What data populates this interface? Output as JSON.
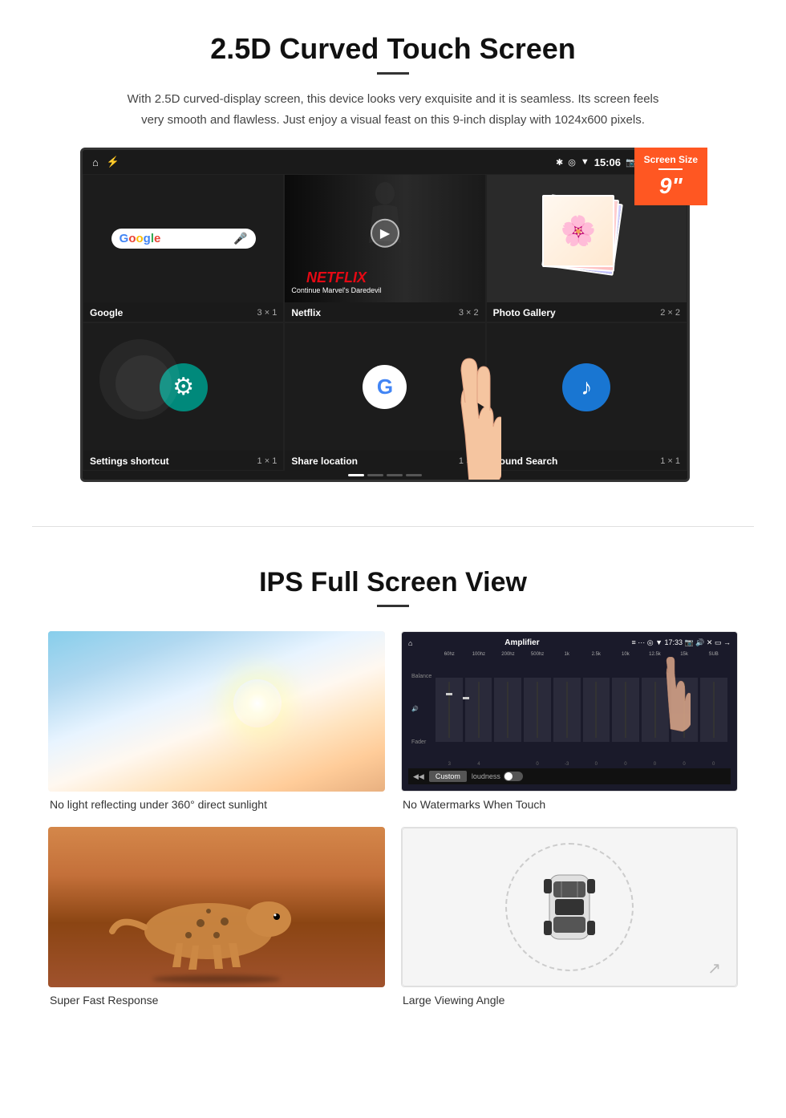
{
  "section1": {
    "title": "2.5D Curved Touch Screen",
    "description": "With 2.5D curved-display screen, this device looks very exquisite and it is seamless. Its screen feels very smooth and flawless. Just enjoy a visual feast on this 9-inch display with 1024x600 pixels.",
    "badge": {
      "label": "Screen Size",
      "size": "9\""
    },
    "statusBar": {
      "time": "15:06"
    },
    "apps": [
      {
        "name": "Google",
        "size": "3 × 1"
      },
      {
        "name": "Netflix",
        "size": "3 × 2"
      },
      {
        "name": "Photo Gallery",
        "size": "2 × 2"
      },
      {
        "name": "Settings shortcut",
        "size": "1 × 1"
      },
      {
        "name": "Share location",
        "size": "1 × 1"
      },
      {
        "name": "Sound Search",
        "size": "1 × 1"
      }
    ],
    "netflix": {
      "logo": "NETFLIX",
      "subtitle": "Continue Marvel's Daredevil"
    },
    "slideIndicator": [
      "active",
      "inactive",
      "inactive",
      "inactive"
    ]
  },
  "section2": {
    "title": "IPS Full Screen View",
    "cards": [
      {
        "caption": "No light reflecting under 360° direct sunlight"
      },
      {
        "caption": "No Watermarks When Touch"
      },
      {
        "caption": "Super Fast Response"
      },
      {
        "caption": "Large Viewing Angle"
      }
    ],
    "amplifier": {
      "title": "Amplifier",
      "time": "17:33",
      "labels": [
        "60hz",
        "100hz",
        "200hz",
        "500hz",
        "1k",
        "2.5k",
        "10k",
        "12.5k",
        "15k",
        "SUB"
      ],
      "sideLabels": [
        "Balance",
        "Fader"
      ],
      "preset": "Custom",
      "loudness": "loudness"
    }
  }
}
